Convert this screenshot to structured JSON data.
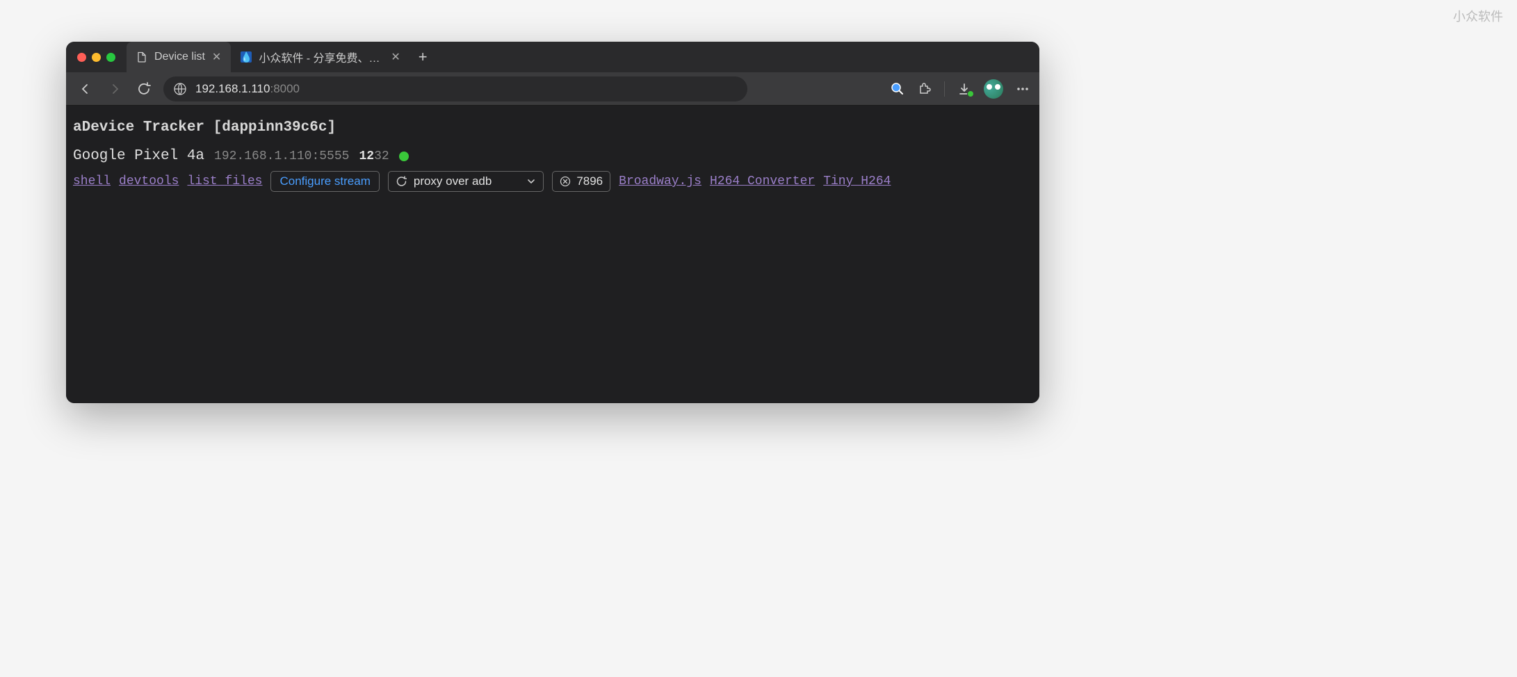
{
  "watermark": "小众软件",
  "browser": {
    "tabs": [
      {
        "title": "Device list",
        "active": true,
        "icon": "file"
      },
      {
        "title": "小众软件 - 分享免费、小巧、实",
        "active": false,
        "icon": "drop"
      }
    ],
    "address": {
      "host": "192.168.1.110",
      "port": ":8000"
    }
  },
  "page": {
    "title": "aDevice Tracker [dappinn39c6c]",
    "device": {
      "name": "Google Pixel 4a",
      "address": "192.168.1.110:5555",
      "version_major": "12",
      "version_minor": "32"
    },
    "links": {
      "shell": "shell",
      "devtools": "devtools",
      "list_files": "list files",
      "broadway": "Broadway.js",
      "h264_converter": "H264 Converter",
      "tiny_h264": "Tiny H264"
    },
    "controls": {
      "configure_label": "Configure stream",
      "proxy_label": "proxy over adb",
      "port_value": "7896"
    }
  }
}
